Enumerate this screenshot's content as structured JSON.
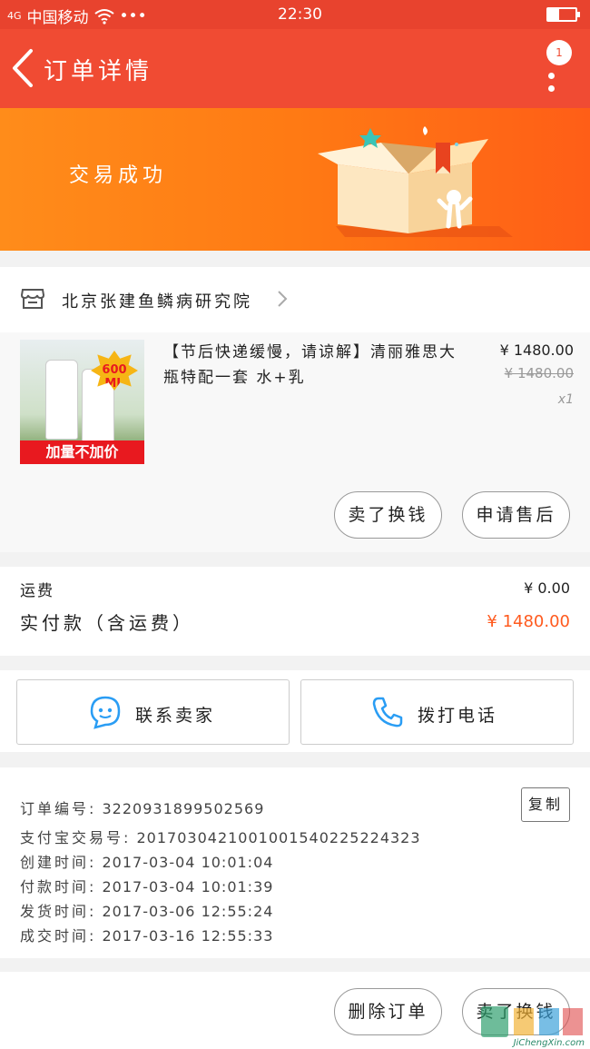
{
  "status_bar": {
    "signal_label": "4G",
    "carrier": "中国移动",
    "dots": "•••",
    "time": "22:30"
  },
  "nav": {
    "title": "订单详情",
    "badge": "1"
  },
  "banner": {
    "status_text": "交易成功"
  },
  "store": {
    "name": "北京张建鱼鳞病研究院"
  },
  "product": {
    "thumb_badge": "600 ML",
    "thumb_caption": "加量不加价",
    "title": "【节后快递缓慢，请谅解】清丽雅思大瓶特配一套 水+乳",
    "price": "¥ 1480.00",
    "original_price": "¥ 1480.00",
    "quantity": "x1",
    "buttons": [
      "卖了换钱",
      "申请售后"
    ]
  },
  "fees": {
    "shipping_label": "运费",
    "shipping_value": "¥ 0.00",
    "paid_label": "实付款（含运费）",
    "paid_value": "¥ 1480.00"
  },
  "actions": {
    "contact_seller": "联系卖家",
    "call_phone": "拨打电话"
  },
  "order_info": {
    "copy_label": "复制",
    "rows": [
      {
        "key": "订单编号:",
        "value": "3220931899502569"
      },
      {
        "key": "支付宝交易号:",
        "value": "2017030421001001540225224323"
      },
      {
        "key": "创建时间:",
        "value": "2017-03-04 10:01:04"
      },
      {
        "key": "付款时间:",
        "value": "2017-03-04 10:01:39"
      },
      {
        "key": "发货时间:",
        "value": "2017-03-06 12:55:24"
      },
      {
        "key": "成交时间:",
        "value": "2017-03-16 12:55:33"
      }
    ]
  },
  "footer": {
    "delete_order": "删除订单",
    "sell_for_cash": "卖了换钱"
  },
  "watermark": {
    "text": "JiChengXin.com"
  },
  "colors": {
    "nav": "#f04b33",
    "banner_start": "#ff8c1a",
    "banner_end": "#ff5e17",
    "price_accent": "#ff5a1e"
  }
}
